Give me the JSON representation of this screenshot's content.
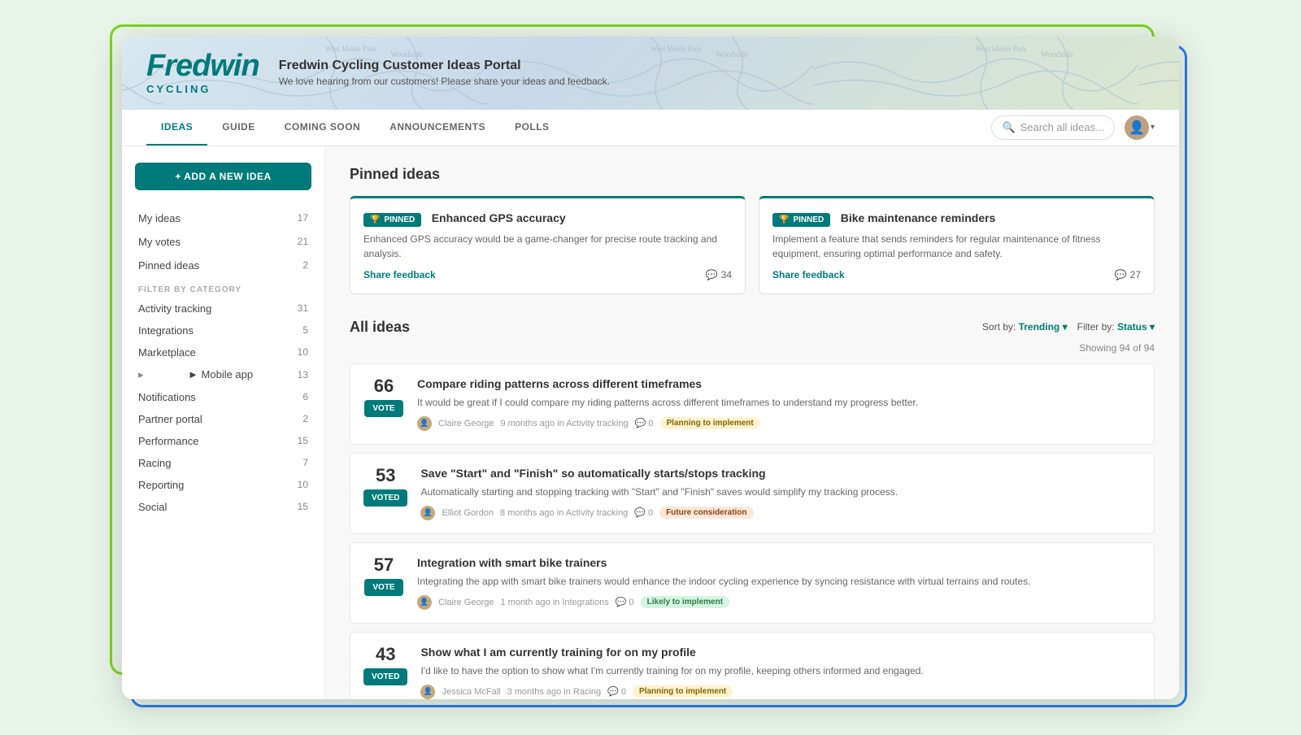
{
  "brand": {
    "name": "Fredwin",
    "cycling": "CYCLING",
    "tagline": "Fredwin Cycling Customer Ideas Portal",
    "subtitle": "We love hearing from our customers! Please share your ideas and feedback."
  },
  "nav": {
    "tabs": [
      {
        "label": "IDEAS",
        "active": true
      },
      {
        "label": "GUIDE",
        "active": false
      },
      {
        "label": "COMING SOON",
        "active": false
      },
      {
        "label": "ANNOUNCEMENTS",
        "active": false
      },
      {
        "label": "POLLS",
        "active": false
      }
    ],
    "search_placeholder": "Search all ideas...",
    "add_idea_label": "+ ADD A NEW IDEA"
  },
  "sidebar": {
    "my_ideas_label": "My ideas",
    "my_ideas_count": "17",
    "my_votes_label": "My votes",
    "my_votes_count": "21",
    "pinned_ideas_label": "Pinned ideas",
    "pinned_ideas_count": "2",
    "filter_by_category": "FILTER BY CATEGORY",
    "categories": [
      {
        "name": "Activity tracking",
        "count": "31",
        "expandable": false
      },
      {
        "name": "Integrations",
        "count": "5",
        "expandable": false
      },
      {
        "name": "Marketplace",
        "count": "10",
        "expandable": false
      },
      {
        "name": "Mobile app",
        "count": "13",
        "expandable": true
      },
      {
        "name": "Notifications",
        "count": "6",
        "expandable": false
      },
      {
        "name": "Partner portal",
        "count": "2",
        "expandable": false
      },
      {
        "name": "Performance",
        "count": "15",
        "expandable": false
      },
      {
        "name": "Racing",
        "count": "7",
        "expandable": false
      },
      {
        "name": "Reporting",
        "count": "10",
        "expandable": false
      },
      {
        "name": "Social",
        "count": "15",
        "expandable": false
      }
    ]
  },
  "pinned_ideas": {
    "section_title": "Pinned ideas",
    "cards": [
      {
        "badge": "PINNED",
        "title": "Enhanced GPS accuracy",
        "description": "Enhanced GPS accuracy would be a game-changer for precise route tracking and analysis.",
        "share_label": "Share feedback",
        "comments": "34"
      },
      {
        "badge": "PINNED",
        "title": "Bike maintenance reminders",
        "description": "Implement a feature that sends reminders for regular maintenance of fitness equipment, ensuring optimal performance and safety.",
        "share_label": "Share feedback",
        "comments": "27"
      }
    ]
  },
  "all_ideas": {
    "section_title": "All ideas",
    "sort_label": "Sort by:",
    "sort_value": "Trending",
    "filter_label": "Filter by:",
    "filter_value": "Status",
    "showing": "Showing 94 of 94",
    "ideas": [
      {
        "votes": "66",
        "vote_label": "VOTE",
        "voted": false,
        "title": "Compare riding patterns across different timeframes",
        "description": "It would be great if I could compare my riding patterns across different timeframes to understand my progress better.",
        "author": "Claire George",
        "time": "9 months ago",
        "category": "Activity tracking",
        "comments": "0",
        "status": "Planning to implement",
        "status_type": "planning"
      },
      {
        "votes": "53",
        "vote_label": "VOTED",
        "voted": true,
        "title": "Save \"Start\" and \"Finish\" so automatically starts/stops tracking",
        "description": "Automatically starting and stopping tracking with \"Start\" and \"Finish\" saves would simplify my tracking process.",
        "author": "Elliot Gordon",
        "time": "8 months ago",
        "category": "Activity tracking",
        "comments": "0",
        "status": "Future consideration",
        "status_type": "future"
      },
      {
        "votes": "57",
        "vote_label": "VOTE",
        "voted": false,
        "title": "Integration with smart bike trainers",
        "description": "Integrating the app with smart bike trainers would enhance the indoor cycling experience by syncing resistance with virtual terrains and routes.",
        "author": "Claire George",
        "time": "1 month ago",
        "category": "Integrations",
        "comments": "0",
        "status": "Likely to implement",
        "status_type": "likely"
      },
      {
        "votes": "43",
        "vote_label": "VOTED",
        "voted": true,
        "title": "Show what I am currently training for on my profile",
        "description": "I'd like to have the option to show what I'm currently training for on my profile, keeping others informed and engaged.",
        "author": "Jessica McFall",
        "time": "3 months ago",
        "category": "Racing",
        "comments": "0",
        "status": "Planning to implement",
        "status_type": "planning"
      }
    ]
  }
}
